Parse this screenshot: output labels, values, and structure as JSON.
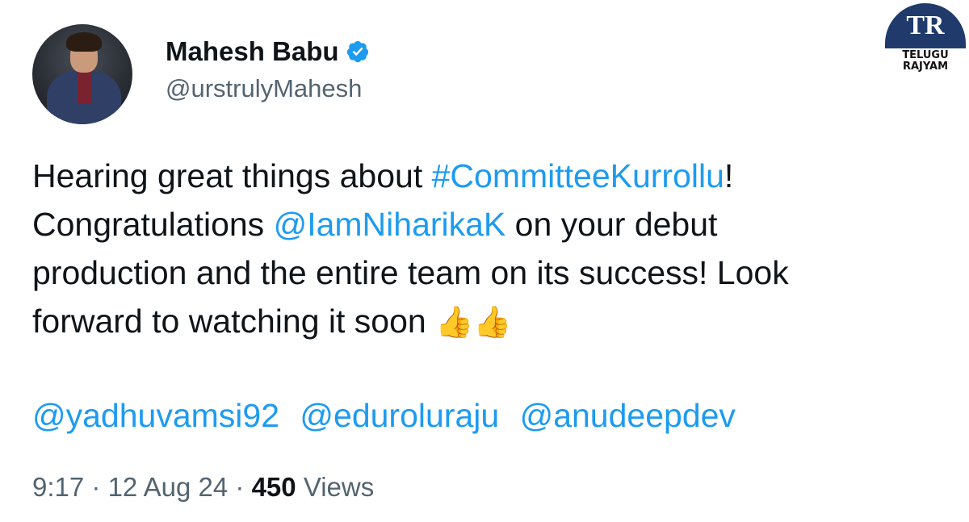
{
  "profile": {
    "name": "Mahesh Babu",
    "handle": "@urstrulyMahesh",
    "verified": true
  },
  "tweet": {
    "line1_text": "Hearing great things about ",
    "line1_hashtag": "#CommitteeKurrollu",
    "line1_end": "!",
    "line2_text": "Congratulations ",
    "line2_mention": "@IamNiharikaK",
    "line2_end": " on your debut",
    "line3": "production and the entire team on its success! Look",
    "line4": "forward to watching it soon ",
    "emoji": "👍👍",
    "mentions": [
      "@yadhuvamsi92",
      "@eduroluraju",
      "@anudeepdev"
    ]
  },
  "meta": {
    "time": "9:17",
    "date": "12 Aug 24",
    "separator": "·",
    "views_count": "450",
    "views_label": "Views"
  },
  "watermark": {
    "monogram": "TR",
    "line1": "TELUGU",
    "line2": "RAJYAM"
  },
  "colors": {
    "link": "#1d9bf0",
    "secondary_text": "#536471",
    "primary_text": "#0f1419",
    "watermark_badge": "#1f3a6b"
  }
}
